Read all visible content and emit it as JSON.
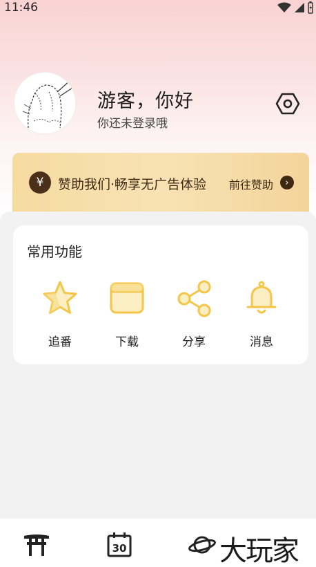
{
  "status_bar": {
    "time": "11:46"
  },
  "profile": {
    "greeting": "游客，你好",
    "login_hint": "你还未登录哦"
  },
  "sponsor": {
    "coin_symbol": "¥",
    "text": "赞助我们·畅享无广告体验",
    "link": "前往赞助"
  },
  "functions": {
    "title": "常用功能",
    "items": [
      {
        "label": "追番",
        "icon": "star-icon"
      },
      {
        "label": "下载",
        "icon": "folder-icon"
      },
      {
        "label": "分享",
        "icon": "share-icon"
      },
      {
        "label": "消息",
        "icon": "bell-icon"
      }
    ]
  },
  "bottom_nav": {
    "items": [
      {
        "icon": "torii-gate-icon"
      },
      {
        "icon": "calendar-icon"
      },
      {
        "icon": "planet-icon"
      }
    ]
  },
  "watermark": {
    "text": "大玩家"
  },
  "colors": {
    "accent_yellow": "#f3c64a",
    "sponsor_brown": "#3e2a14"
  }
}
